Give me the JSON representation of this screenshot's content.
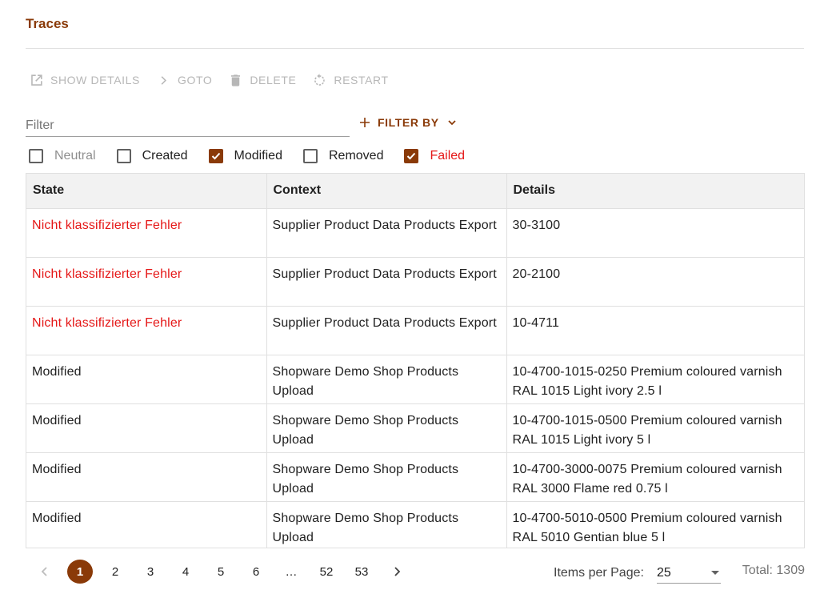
{
  "title": "Traces",
  "toolbar": {
    "show_details": "SHOW DETAILS",
    "goto": "GOTO",
    "delete": "DELETE",
    "restart": "RESTART"
  },
  "filter": {
    "placeholder": "Filter",
    "filter_by": "FILTER BY"
  },
  "checkboxes": [
    {
      "label": "Neutral",
      "checked": false
    },
    {
      "label": "Created",
      "checked": false
    },
    {
      "label": "Modified",
      "checked": true
    },
    {
      "label": "Removed",
      "checked": false
    },
    {
      "label": "Failed",
      "checked": true
    }
  ],
  "table": {
    "headers": [
      "State",
      "Context",
      "Details"
    ],
    "rows": [
      {
        "state": "Nicht klassifizierter Fehler",
        "context": "Supplier Product Data Products Export",
        "details": "30-3100"
      },
      {
        "state": "Nicht klassifizierter Fehler",
        "context": "Supplier Product Data Products Export",
        "details": "20-2100"
      },
      {
        "state": "Nicht klassifizierter Fehler",
        "context": "Supplier Product Data Products Export",
        "details": "10-4711"
      },
      {
        "state": "Modified",
        "context": "Shopware Demo Shop Products Upload",
        "details": "10-4700-1015-0250 Premium coloured varnish RAL 1015 Light ivory 2.5 l"
      },
      {
        "state": "Modified",
        "context": "Shopware Demo Shop Products Upload",
        "details": "10-4700-1015-0500 Premium coloured varnish RAL 1015 Light ivory 5 l"
      },
      {
        "state": "Modified",
        "context": "Shopware Demo Shop Products Upload",
        "details": "10-4700-3000-0075 Premium coloured varnish RAL 3000 Flame red 0.75 l"
      },
      {
        "state": "Modified",
        "context": "Shopware Demo Shop Products Upload",
        "details": "10-4700-5010-0500 Premium coloured varnish RAL 5010 Gentian blue 5 l"
      }
    ]
  },
  "pagination": {
    "pages": [
      "1",
      "2",
      "3",
      "4",
      "5",
      "6",
      "…",
      "52",
      "53"
    ],
    "current": "1",
    "items_per_page_label": "Items per Page:",
    "items_per_page": "25",
    "total": "Total: 1309"
  },
  "colors": {
    "accent": "#8a3a08",
    "error": "#e51717",
    "disabled": "#b7b7b7"
  }
}
